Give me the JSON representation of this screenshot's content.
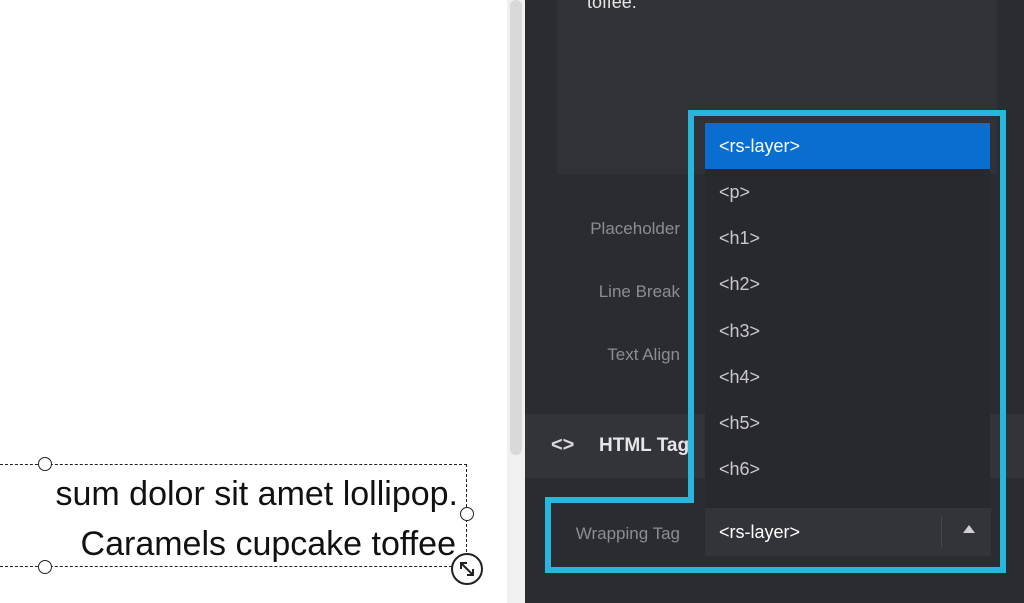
{
  "canvas": {
    "text_line_1": "sum dolor sit amet lollipop.",
    "text_line_2": "Caramels cupcake toffee"
  },
  "panel": {
    "editor_text": "toffee.",
    "labels": {
      "placeholder": "Placeholder",
      "line_break": "Line Break",
      "text_align": "Text Align"
    },
    "section": {
      "icon": "code-icon",
      "icon_glyph": "<>",
      "title": "HTML Tag"
    },
    "wrapping_tag": {
      "label": "Wrapping Tag",
      "value": "<rs-layer>"
    }
  },
  "dropdown": {
    "options": [
      "<rs-layer>",
      "<p>",
      "<h1>",
      "<h2>",
      "<h3>",
      "<h4>",
      "<h5>",
      "<h6>"
    ],
    "selected": "<rs-layer>"
  },
  "colors": {
    "accent_highlight": "#29b6dd",
    "selected_option": "#0a6ed1",
    "panel_bg": "#2b2c31"
  }
}
